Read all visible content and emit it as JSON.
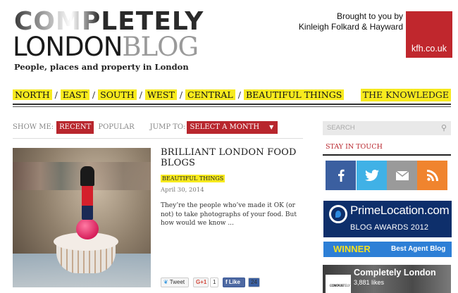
{
  "header": {
    "logo_top": "COMPLETELY",
    "logo_london": "LONDON",
    "logo_blog": "BLOG",
    "tagline": "People, places and property in London",
    "brought_line1": "Brought to you by",
    "brought_line2": "Kinleigh Folkard & Hayward",
    "kfh_label": "kfh.co.uk",
    "kfh_color": "#c0272d"
  },
  "nav": {
    "items": [
      "NORTH",
      "EAST",
      "SOUTH",
      "WEST",
      "CENTRAL",
      "BEAUTIFUL THINGS"
    ],
    "separator": "/",
    "knowledge": "THE KNOWLEDGE",
    "highlight_color": "#f7ea1e"
  },
  "filters": {
    "show_me": "SHOW ME:",
    "recent": "RECENT",
    "popular": "POPULAR",
    "jump_to": "JUMP TO:",
    "month_select": "SELECT A MONTH",
    "accent": "#b8262d"
  },
  "post": {
    "title": "BRILLIANT LONDON FOOD BLOGS",
    "category": "BEAUTIFUL THINGS",
    "date": "April 30, 2014",
    "excerpt": "They’re the people who’ve made it OK (or not) to take photographs of your food. But how would we know ...",
    "share": {
      "tweet": "Tweet",
      "gplus": "G+1",
      "gplus_count": "1",
      "like": "Like",
      "like_count": "24"
    }
  },
  "sidebar": {
    "search_placeholder": "SEARCH",
    "stay_in_touch": "STAY IN TOUCH",
    "social": [
      "facebook-icon",
      "twitter-icon",
      "email-icon",
      "rss-icon"
    ],
    "primelocation": {
      "brand": "PrimeLocation.com",
      "awards": "BLOG AWARDS 2012",
      "winner": "WINNER",
      "best": "Best Agent Blog"
    },
    "facebook_box": {
      "mini_logo_line1": "COMPLETELY",
      "mini_logo_line2": "LONDON",
      "name": "Completely London",
      "likes": "3,881 likes"
    }
  }
}
